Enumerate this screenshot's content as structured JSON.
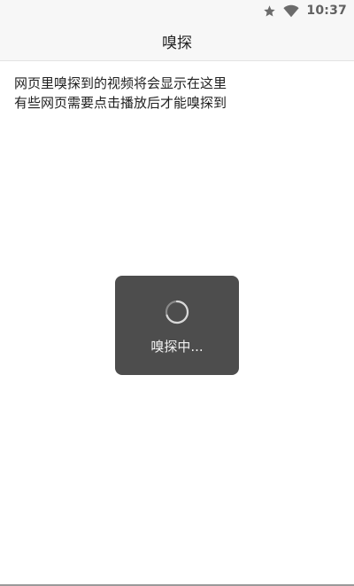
{
  "status_bar": {
    "time": "10:37",
    "icons": [
      "star-icon",
      "wifi-icon"
    ]
  },
  "header": {
    "title": "嗅探"
  },
  "main": {
    "hint_lines": [
      "网页里嗅探到的视频将会显示在这里",
      "有些网页需要点击播放后才能嗅探到"
    ]
  },
  "loading": {
    "text": "嗅探中..."
  },
  "colors": {
    "toast_background": "#4d4d4d",
    "bar_background": "#f7f7f7"
  }
}
